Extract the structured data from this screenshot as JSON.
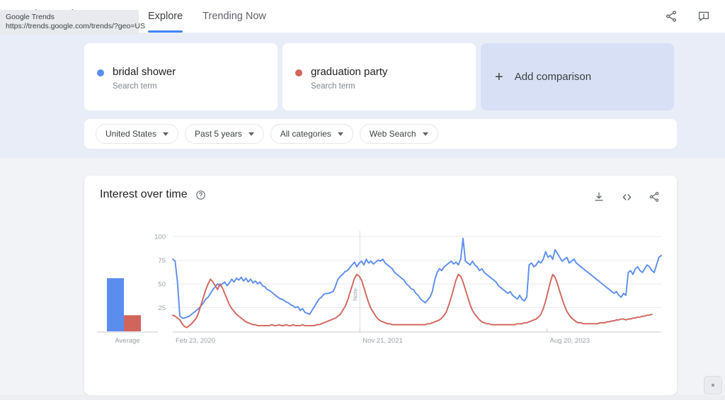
{
  "browser": {
    "link_tooltip": {
      "title": "Google Trends",
      "url": "https://trends.google.com/trends/?geo=US"
    }
  },
  "header": {
    "brand": "Google Trends",
    "tabs": [
      {
        "label": "Explore",
        "active": true
      },
      {
        "label": "Trending Now",
        "active": false
      }
    ],
    "actions": [
      {
        "name": "share-icon",
        "label": "Share"
      },
      {
        "name": "feedback-icon",
        "label": "Send feedback"
      }
    ]
  },
  "terms": [
    {
      "name": "bridal shower",
      "sub": "Search term",
      "color": "#5b8def"
    },
    {
      "name": "graduation party",
      "sub": "Search term",
      "color": "#d1655c"
    }
  ],
  "add_comparison": {
    "label": "Add comparison",
    "plus": "+"
  },
  "filters": [
    {
      "label": "United States",
      "name": "location-filter"
    },
    {
      "label": "Past 5 years",
      "name": "time-range-filter"
    },
    {
      "label": "All categories",
      "name": "category-filter"
    },
    {
      "label": "Web Search",
      "name": "search-type-filter"
    }
  ],
  "interest_over_time": {
    "title": "Interest over time",
    "help_icon": "help-circle-icon",
    "actions": [
      {
        "name": "download-icon",
        "label": "Download CSV"
      },
      {
        "name": "embed-code-icon",
        "label": "Embed"
      },
      {
        "name": "share-icon",
        "label": "Share"
      }
    ],
    "average_label": "Average",
    "note_label": "Note"
  },
  "chart_data": {
    "type": "line",
    "title": "Interest over time",
    "xlabel": "",
    "ylabel": "",
    "ylim": [
      0,
      100
    ],
    "yticks": [
      25,
      50,
      75,
      100
    ],
    "grid": true,
    "legend_position": "cards-above",
    "xticks": [
      "Feb 23, 2020",
      "Nov 21, 2021",
      "Aug 20, 2023"
    ],
    "x_domain": [
      "Feb 23, 2020",
      "Feb 2025"
    ],
    "annotations": [
      {
        "label": "Note",
        "x_fraction": 0.383,
        "type": "vertical-line"
      }
    ],
    "averages": {
      "categories": [
        "Average"
      ],
      "series": [
        {
          "name": "bridal shower",
          "color": "#5b8def",
          "value": 56
        },
        {
          "name": "graduation party",
          "color": "#d1655c",
          "value": 17
        }
      ]
    },
    "series": [
      {
        "name": "bridal shower",
        "color": "#5b8def",
        "values": [
          76,
          74,
          52,
          16,
          14,
          14,
          15,
          16,
          18,
          20,
          22,
          24,
          27,
          30,
          34,
          36,
          40,
          44,
          47,
          50,
          48,
          50,
          52,
          48,
          51,
          55,
          52,
          56,
          54,
          57,
          53,
          56,
          52,
          55,
          51,
          53,
          50,
          52,
          48,
          47,
          44,
          43,
          41,
          39,
          37,
          35,
          34,
          33,
          31,
          30,
          28,
          27,
          25,
          26,
          22,
          24,
          20,
          19,
          18,
          22,
          26,
          30,
          34,
          36,
          39,
          40,
          40,
          41,
          42,
          48,
          55,
          58,
          60,
          63,
          64,
          67,
          70,
          73,
          68,
          72,
          74,
          70,
          76,
          72,
          74,
          71,
          73,
          75,
          74,
          76,
          72,
          70,
          68,
          66,
          62,
          60,
          58,
          56,
          54,
          50,
          48,
          45,
          44,
          40,
          38,
          34,
          32,
          30,
          33,
          36,
          42,
          54,
          62,
          66,
          64,
          68,
          70,
          72,
          74,
          71,
          73,
          70,
          76,
          98,
          74,
          72,
          70,
          74,
          70,
          68,
          64,
          66,
          62,
          60,
          58,
          56,
          54,
          52,
          48,
          46,
          44,
          42,
          40,
          42,
          38,
          36,
          34,
          38,
          34,
          32,
          36,
          70,
          72,
          68,
          70,
          74,
          72,
          76,
          84,
          78,
          80,
          76,
          86,
          82,
          78,
          74,
          76,
          78,
          72,
          74,
          76,
          72,
          70,
          68,
          66,
          64,
          62,
          60,
          58,
          56,
          54,
          52,
          50,
          48,
          46,
          44,
          42,
          40,
          42,
          38,
          36,
          40,
          38,
          62,
          64,
          60,
          66,
          68,
          64,
          62,
          66,
          70,
          68,
          64,
          62,
          70,
          78,
          80
        ],
        "min": 14,
        "max": 100
      },
      {
        "name": "graduation party",
        "color": "#d1655c",
        "values": [
          17,
          16,
          14,
          12,
          8,
          5,
          4,
          6,
          8,
          11,
          14,
          20,
          28,
          36,
          44,
          50,
          55,
          52,
          48,
          44,
          50,
          46,
          40,
          34,
          28,
          24,
          21,
          18,
          16,
          14,
          12,
          10,
          9,
          8,
          7,
          7,
          6,
          6,
          6,
          6,
          6,
          6,
          7,
          6,
          6,
          7,
          6,
          6,
          7,
          6,
          6,
          7,
          6,
          6,
          6,
          7,
          6,
          6,
          6,
          6,
          6,
          7,
          7,
          8,
          9,
          10,
          11,
          12,
          13,
          14,
          16,
          18,
          22,
          26,
          32,
          40,
          48,
          56,
          60,
          58,
          54,
          46,
          38,
          30,
          24,
          20,
          16,
          13,
          11,
          10,
          9,
          8,
          8,
          7,
          7,
          7,
          7,
          7,
          7,
          7,
          7,
          7,
          7,
          7,
          7,
          7,
          7,
          7,
          8,
          8,
          9,
          10,
          11,
          12,
          14,
          17,
          21,
          28,
          36,
          45,
          54,
          60,
          58,
          52,
          44,
          36,
          28,
          22,
          18,
          15,
          12,
          10,
          9,
          8,
          8,
          7,
          7,
          7,
          7,
          7,
          7,
          7,
          7,
          7,
          7,
          7,
          8,
          8,
          8,
          9,
          9,
          10,
          11,
          12,
          13,
          15,
          18,
          24,
          32,
          42,
          52,
          60,
          57,
          50,
          42,
          34,
          27,
          21,
          17,
          14,
          12,
          10,
          9,
          9,
          8,
          8,
          8,
          8,
          8,
          8,
          8,
          9,
          9,
          9,
          10,
          10,
          11,
          11,
          12,
          12,
          13,
          13,
          12,
          13,
          13,
          14,
          14,
          15,
          15,
          16,
          16,
          17,
          17,
          18
        ],
        "min": 4,
        "max": 60
      }
    ]
  }
}
